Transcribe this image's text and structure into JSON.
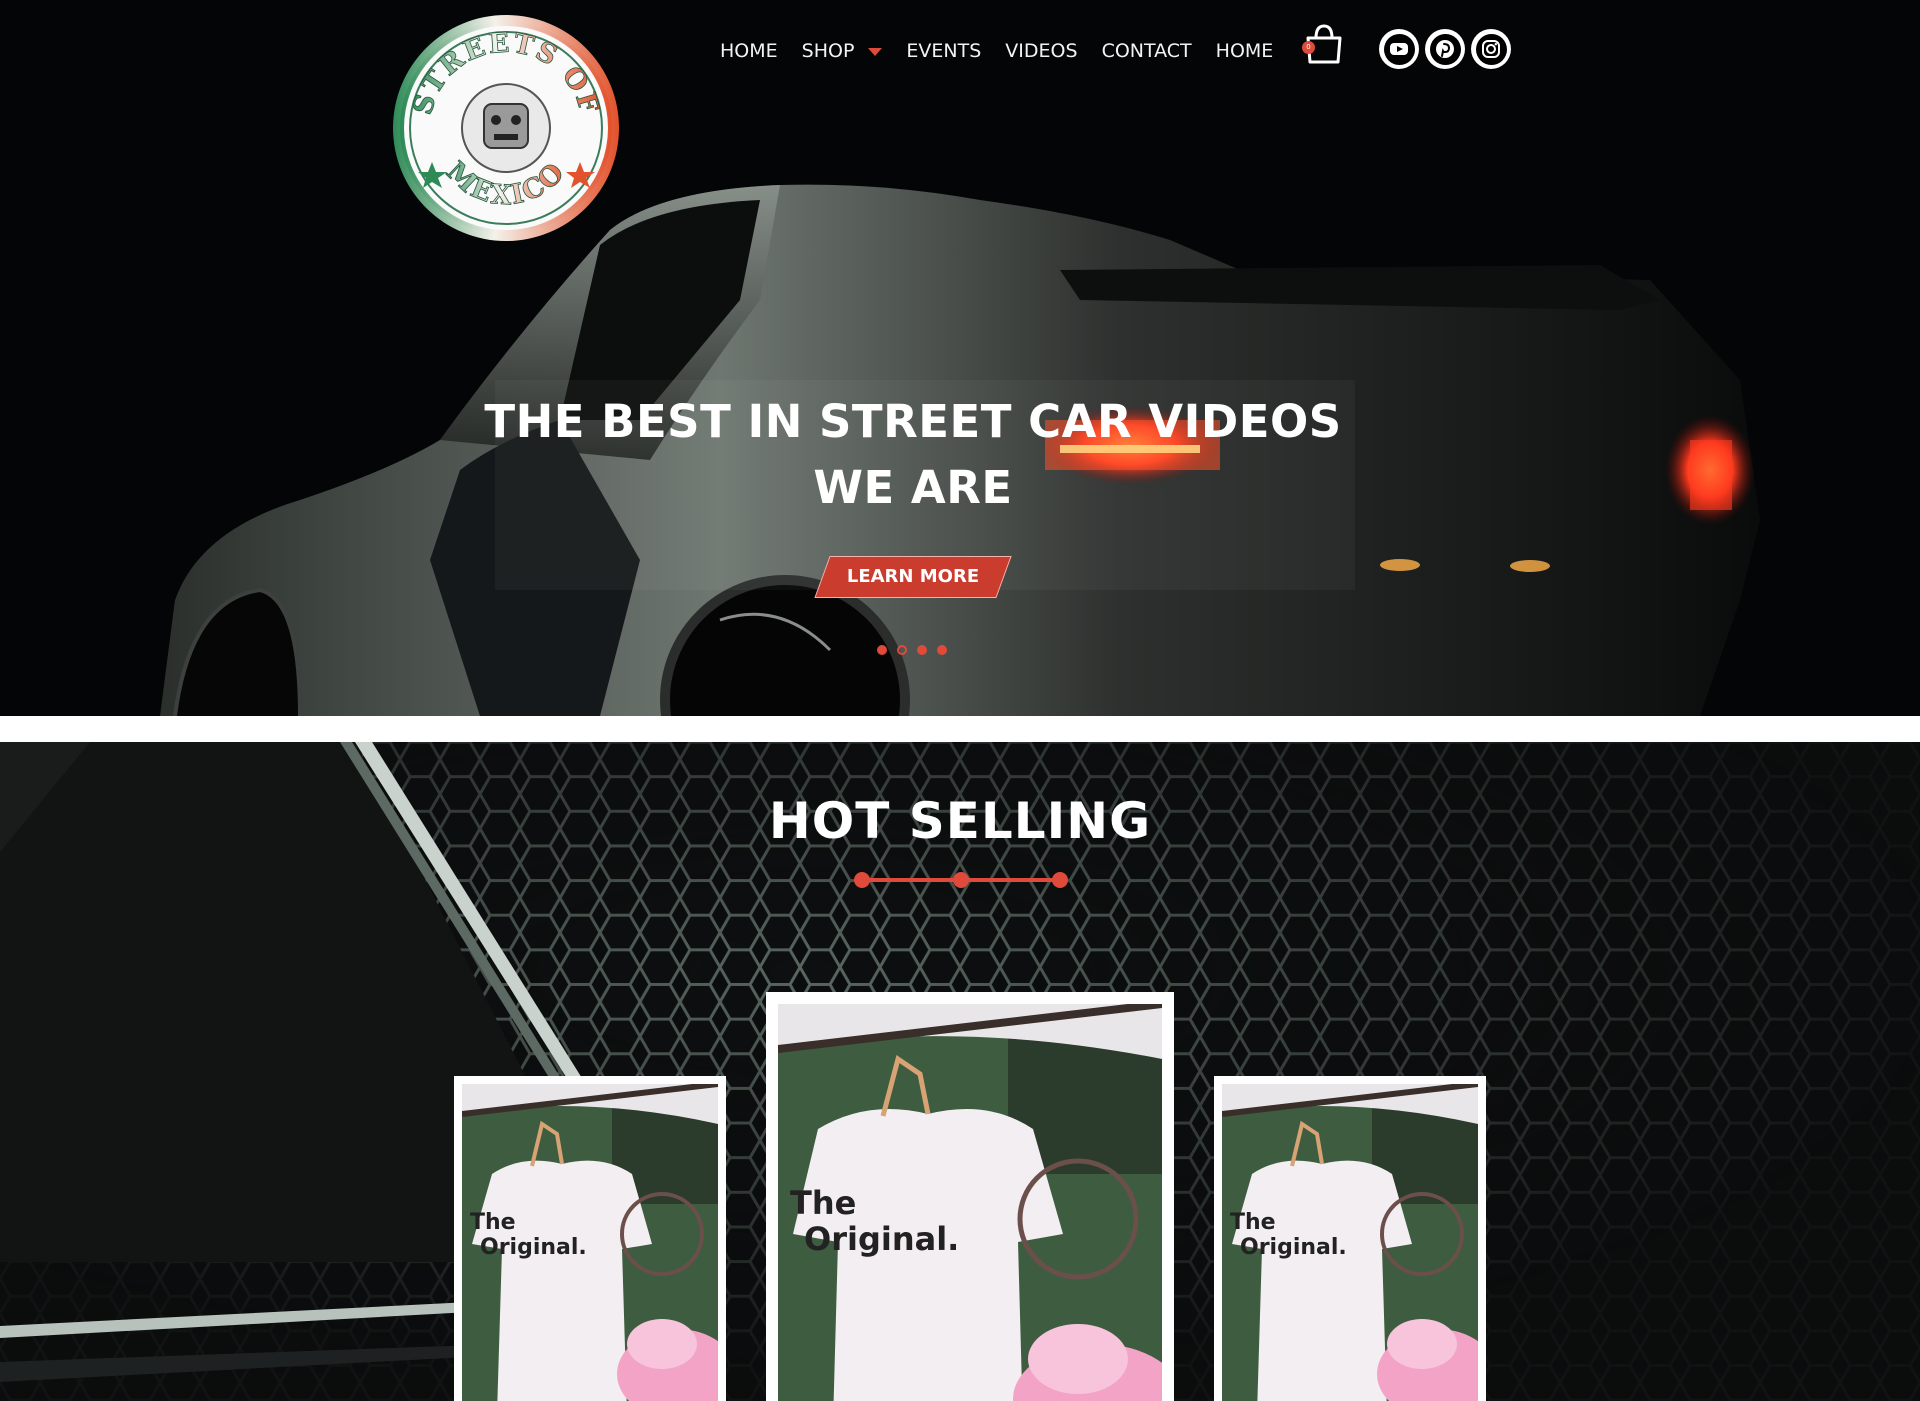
{
  "brand": {
    "logo_top": "STREETS OF",
    "logo_bottom": "MEXICO"
  },
  "nav": {
    "items": [
      {
        "label": "HOME"
      },
      {
        "label": "SHOP"
      },
      {
        "label": "EVENTS"
      },
      {
        "label": "VIDEOS"
      },
      {
        "label": "CONTACT"
      },
      {
        "label": "HOME"
      }
    ]
  },
  "cart": {
    "count": "0",
    "icon": "shopping-bag-icon"
  },
  "social": [
    {
      "icon": "youtube-icon"
    },
    {
      "icon": "pinterest-icon"
    },
    {
      "icon": "instagram-icon"
    }
  ],
  "hero": {
    "headline_line1": "THE BEST IN STREET CAR VIDEOS",
    "headline_line2": "WE ARE",
    "cta_label": "LEARN MORE",
    "slide_count": 4,
    "active_slide": 2
  },
  "hot_selling": {
    "title": "HOT SELLING",
    "products": [
      {
        "shirt_text_1": "The",
        "shirt_text_2": "Original."
      },
      {
        "shirt_text_1": "The",
        "shirt_text_2": "Original."
      },
      {
        "shirt_text_1": "The",
        "shirt_text_2": "Original."
      }
    ]
  },
  "colors": {
    "accent": "#e04a3a",
    "background": "#040506"
  }
}
